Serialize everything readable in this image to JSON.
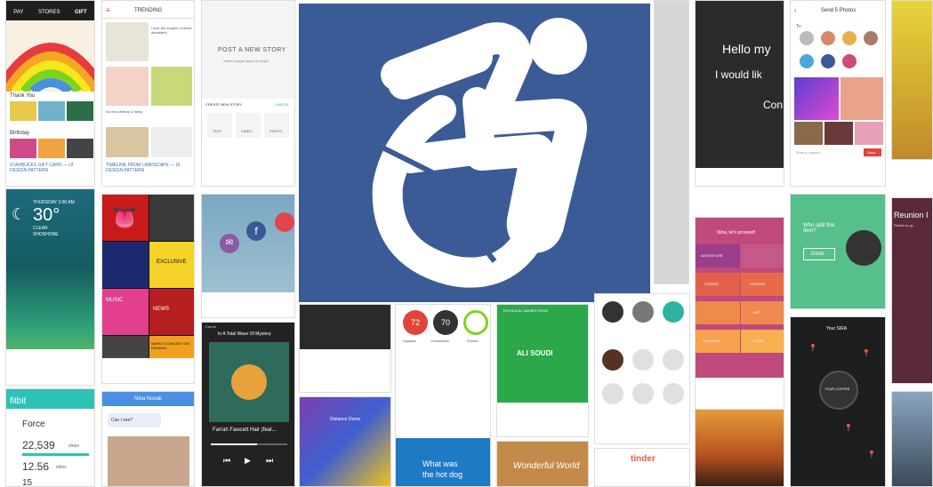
{
  "tiles": {
    "gift": {
      "tabs": [
        "PAY",
        "STORES",
        "GIFT"
      ],
      "section_thanks": "Thank You",
      "section_birthday": "Birthday",
      "caption": "STARBUCKS GIFT CARD — UI DESIGN PATTERN"
    },
    "trending": {
      "title": "TRENDING",
      "caption": "TIMELINE FROM LANDSCAPE — UI DESIGN PATTERN",
      "card1": "I love the shapes of these decanters",
      "card2": "So mid-century & funky"
    },
    "post_story": {
      "heading": "POST A NEW STORY",
      "sub": "select a page layout to begin",
      "create": "CREATE NEW STORY",
      "cancel": "CANCEL",
      "opts": [
        "TEXT",
        "VIDEO",
        "PHOTO"
      ]
    },
    "weather": {
      "date": "THURSDAY 3:00 AM",
      "temp": "30°",
      "cond": "CLEAR",
      "place": "SHOSHONE"
    },
    "music": {
      "exclusive": "EXCLUSIVE",
      "music": "MUSIC",
      "news": "NEWS",
      "march": "MARCH CONCERT ON DEMAND"
    },
    "player": {
      "track": "In A Total Wave Of Mystery",
      "artist": "Farrah Fawcett Hair (feat...",
      "carrier": "Carrier"
    },
    "fitbit": {
      "brand": "fitbit",
      "force": "Force",
      "steps": "22,539",
      "steps_unit": "steps",
      "miles": "12.56",
      "miles_unit": "miles",
      "floors": "15"
    },
    "chat": {
      "name": "Nina Novak",
      "msg": "Can I see?"
    },
    "dashboard": {
      "v1": "72",
      "v2": "70",
      "l1": "Upstairs",
      "l2": "Downstairs",
      "l3": "Protect"
    },
    "ali": {
      "name": "ALI SOUDI",
      "label": "TECHNICAL NAMES FROM"
    },
    "hotdog": {
      "line1": "What was",
      "line2": "the hot dog"
    },
    "hello": {
      "line1": "Hello my",
      "line2": "I would lik",
      "line3": "Con"
    },
    "send_photos": {
      "title": "Send 5 Photos",
      "to": "To:",
      "write": "Write a caption...",
      "send": "Send"
    },
    "split": {
      "question": "Who split this item?",
      "done": "Done"
    },
    "cuisine": {
      "title": "Wow, let's proceed!",
      "items": [
        "ADVENTURE",
        "COFFEE",
        "VINTAGE",
        "ART",
        "CULINARY",
        "FOOD"
      ]
    },
    "map": {
      "title": "Your SIRA",
      "center": "TOUR COFFEE"
    },
    "reunion": {
      "title": "Reunion I",
      "sub": "Places to go"
    },
    "tinder": {
      "brand": "tinder"
    },
    "wonderful": {
      "text": "Wonderful World"
    },
    "distance": {
      "title": "Distance Demo"
    },
    "center_logo_name": "accessible icon",
    "colors": {
      "logo_bg": "#3a5b95"
    }
  }
}
